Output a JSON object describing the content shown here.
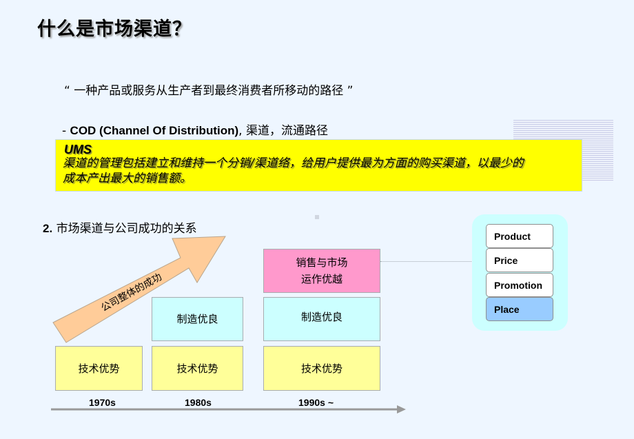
{
  "title": "什么是市场渠道？",
  "definition_quote": "“ 一种产品或服务从生产者到最终消费者所移动的路径 ”",
  "cod_line": {
    "prefix": "-  ",
    "bold": "COD (Channel Of Distribution)",
    "rest": ", 渠道，流通路径"
  },
  "ums": {
    "title": "UMS",
    "text_line1": "渠道的管理包括建立和维持一个分销/渠道络，给用户提供最为方面的购买渠道，以最少的",
    "text_line2": "成本产出最大的销售额。"
  },
  "section": {
    "number": "2.",
    "label": " 市场渠道与公司成功的关系"
  },
  "growth_arrow": {
    "label": "公司整体的成功",
    "color": "#ffcc99"
  },
  "eras": [
    {
      "label": "1970s",
      "layers": [
        "技术优势"
      ]
    },
    {
      "label": "1980s",
      "layers": [
        "技术优势",
        "制造优良"
      ]
    },
    {
      "label": "1990s ~",
      "layers": [
        "技术优势",
        "制造优良",
        "销售与市场\n运作优越"
      ]
    }
  ],
  "layer_labels": {
    "tech": "技术优势",
    "manufacturing": "制造优良",
    "sales_line1": "销售与市场",
    "sales_line2": "运作优越"
  },
  "colors": {
    "background": "#eef6ff",
    "ums_box": "#ffff00",
    "tech": "#ffff99",
    "manufacturing": "#ccffff",
    "sales": "#ff99cc",
    "mix_panel": "#ccffff",
    "mix_active": "#99ccff",
    "timeline": "#999999"
  },
  "marketing_mix": {
    "items": [
      {
        "label": "Product",
        "active": false
      },
      {
        "label": "Price",
        "active": false
      },
      {
        "label": "Promotion",
        "active": false
      },
      {
        "label": "Place",
        "active": true
      }
    ]
  }
}
